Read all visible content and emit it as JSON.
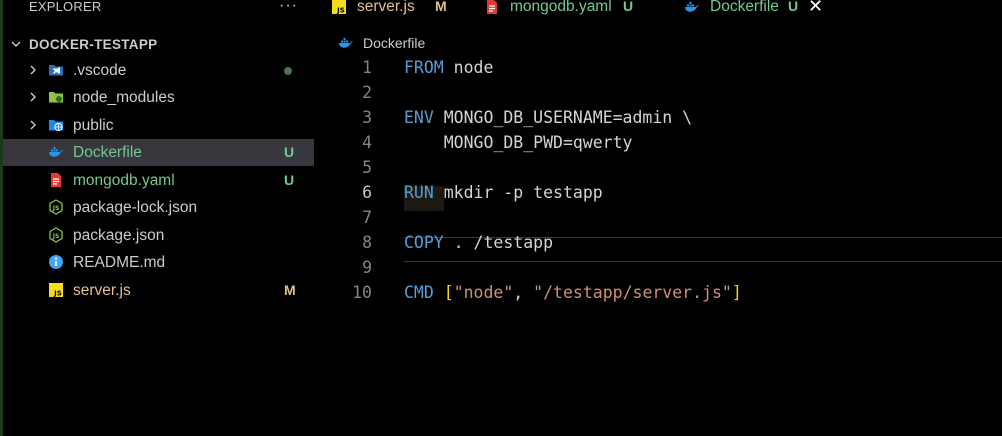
{
  "explorer": {
    "title": "EXPLORER",
    "more": "···",
    "root": "DOCKER-TESTAPP",
    "items": [
      {
        "name": ".vscode",
        "kind": "folder",
        "status": "",
        "icon": "vscode-folder-icon"
      },
      {
        "name": "node_modules",
        "kind": "folder",
        "status": "",
        "icon": "node-folder-icon"
      },
      {
        "name": "public",
        "kind": "folder",
        "status": "",
        "icon": "public-folder-icon"
      },
      {
        "name": "Dockerfile",
        "kind": "file",
        "status": "U",
        "icon": "docker-icon"
      },
      {
        "name": "mongodb.yaml",
        "kind": "file",
        "status": "U",
        "icon": "yaml-icon"
      },
      {
        "name": "package-lock.json",
        "kind": "file",
        "status": "",
        "icon": "nodejs-icon"
      },
      {
        "name": "package.json",
        "kind": "file",
        "status": "",
        "icon": "nodejs-icon"
      },
      {
        "name": "README.md",
        "kind": "file",
        "status": "",
        "icon": "info-icon"
      },
      {
        "name": "server.js",
        "kind": "file",
        "status": "M",
        "icon": "js-icon"
      }
    ]
  },
  "tabs": [
    {
      "name": "server.js",
      "status": "M",
      "icon": "js-icon"
    },
    {
      "name": "mongodb.yaml",
      "status": "U",
      "icon": "yaml-icon"
    },
    {
      "name": "Dockerfile",
      "status": "U",
      "icon": "docker-icon",
      "close": "✕"
    }
  ],
  "breadcrumb": "Dockerfile",
  "editor": {
    "lines": [
      {
        "n": "1",
        "tokens": [
          [
            "kw",
            "FROM"
          ],
          [
            "plain",
            " node"
          ]
        ]
      },
      {
        "n": "2",
        "tokens": []
      },
      {
        "n": "3",
        "tokens": [
          [
            "kw",
            "ENV"
          ],
          [
            "plain",
            " MONGO_DB_USERNAME=admin \\"
          ]
        ]
      },
      {
        "n": "4",
        "tokens": [
          [
            "plain",
            "    MONGO_DB_PWD=qwerty"
          ]
        ]
      },
      {
        "n": "5",
        "tokens": []
      },
      {
        "n": "6",
        "tokens": [
          [
            "kw",
            "RUN"
          ],
          [
            "plain",
            " mkdir -p testapp"
          ]
        ]
      },
      {
        "n": "7",
        "tokens": []
      },
      {
        "n": "8",
        "tokens": [
          [
            "kw",
            "COPY"
          ],
          [
            "plain",
            " . /testapp"
          ]
        ]
      },
      {
        "n": "9",
        "tokens": []
      },
      {
        "n": "10",
        "tokens": [
          [
            "kw",
            "CMD"
          ],
          [
            "plain",
            " "
          ],
          [
            "br",
            "["
          ],
          [
            "str",
            "\"node\""
          ],
          [
            "plain",
            ", "
          ],
          [
            "str",
            "\"/testapp/server.js\""
          ],
          [
            "br",
            "]"
          ]
        ]
      }
    ]
  },
  "colors": {
    "keyword": "#569cd6",
    "string": "#ce9178",
    "untracked": "#73c991",
    "modified": "#e2c08d"
  }
}
